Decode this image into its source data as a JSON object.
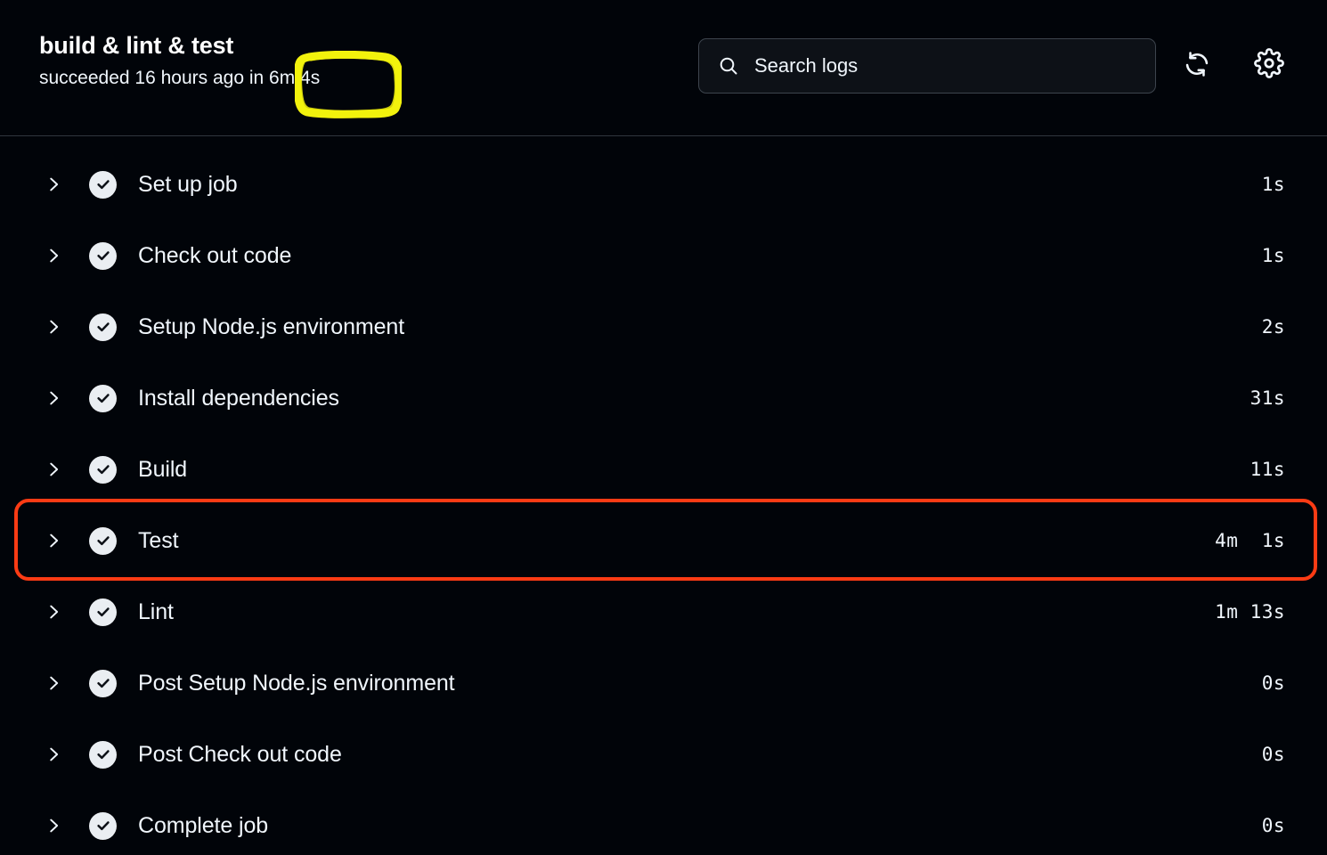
{
  "header": {
    "job_title": "build & lint & test",
    "status_text": "succeeded 16 hours ago in 6m 4s",
    "highlighted_duration": "6m 4s",
    "annotation_color": "#f2f20d"
  },
  "search": {
    "placeholder": "Search logs",
    "value": "",
    "icon": "search-icon"
  },
  "toolbar": {
    "refresh_icon": "refresh-icon",
    "settings_icon": "gear-icon"
  },
  "annotations": {
    "red_box_color": "#fb3b14",
    "red_box_target": "Test",
    "yellow_box_color": "#f2f20d",
    "yellow_box_target": "6m 4s"
  },
  "steps": [
    {
      "name": "Set up job",
      "duration": "1s",
      "status": "success",
      "expanded": false,
      "highlighted": false
    },
    {
      "name": "Check out code",
      "duration": "1s",
      "status": "success",
      "expanded": false,
      "highlighted": false
    },
    {
      "name": "Setup Node.js environment",
      "duration": "2s",
      "status": "success",
      "expanded": false,
      "highlighted": false
    },
    {
      "name": "Install dependencies",
      "duration": "31s",
      "status": "success",
      "expanded": false,
      "highlighted": false
    },
    {
      "name": "Build",
      "duration": "11s",
      "status": "success",
      "expanded": false,
      "highlighted": false
    },
    {
      "name": "Test",
      "duration": "4m  1s",
      "status": "success",
      "expanded": false,
      "highlighted": true
    },
    {
      "name": "Lint",
      "duration": "1m 13s",
      "status": "success",
      "expanded": false,
      "highlighted": false
    },
    {
      "name": "Post Setup Node.js environment",
      "duration": "0s",
      "status": "success",
      "expanded": false,
      "highlighted": false
    },
    {
      "name": "Post Check out code",
      "duration": "0s",
      "status": "success",
      "expanded": false,
      "highlighted": false
    },
    {
      "name": "Complete job",
      "duration": "0s",
      "status": "success",
      "expanded": false,
      "highlighted": false
    }
  ]
}
